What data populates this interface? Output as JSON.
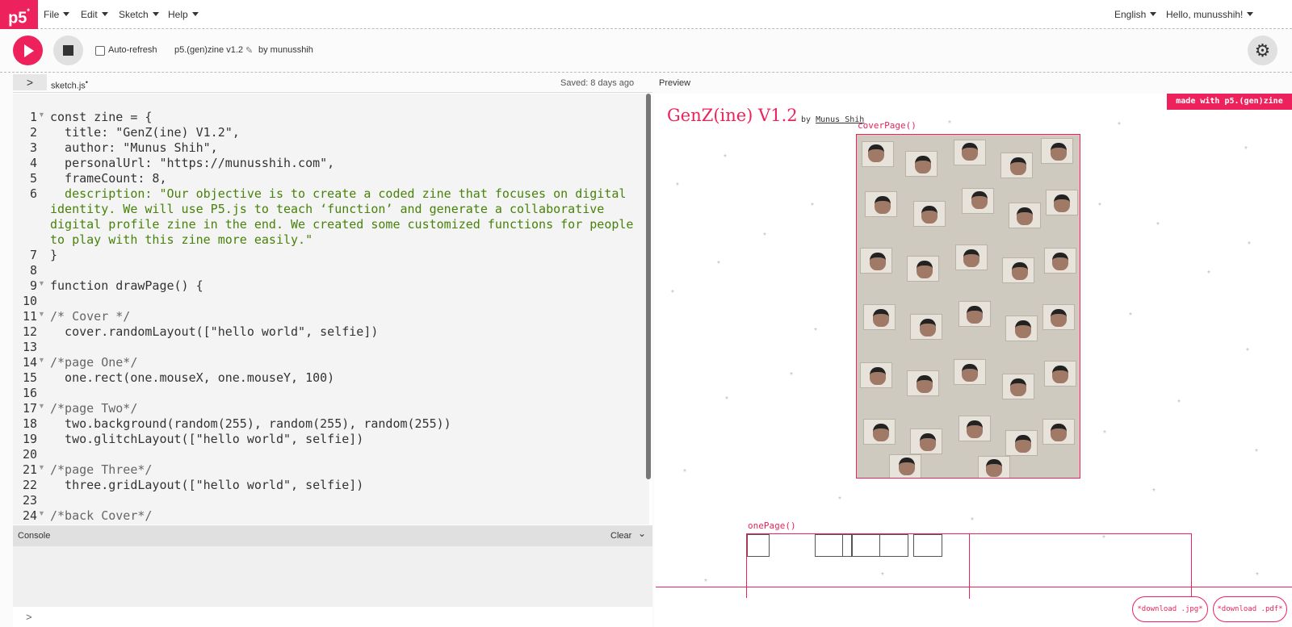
{
  "menubar": {
    "logo": "p5",
    "logo_sup": "*",
    "items": [
      "File",
      "Edit",
      "Sketch",
      "Help"
    ],
    "language": "English",
    "user": "Hello, munusshih!"
  },
  "toolbar": {
    "auto_refresh_label": "Auto-refresh",
    "sketch_name": "p5.(gen)zine v1.2",
    "by_user": "by munusshih"
  },
  "editor": {
    "toggle_glyph": ">",
    "filename": "sketch.js",
    "unsaved_marker": "•",
    "saved_status": "Saved: 8 days ago",
    "line_numbers": [
      "1",
      "2",
      "3",
      "4",
      "5",
      "6",
      "7",
      "8",
      "9",
      "10",
      "11",
      "12",
      "13",
      "14",
      "15",
      "16",
      "17",
      "18",
      "19",
      "20",
      "21",
      "22",
      "23",
      "24"
    ],
    "lines": [
      "const zine = {",
      "  title: \"GenZ(ine) V1.2\",",
      "  author: \"Munus Shih\",",
      "  personalUrl: \"https://munusshih.com\",",
      "  frameCount: 8,",
      "  description: \"Our objective is to create a coded zine that focuses on digital",
      "identity. We will use P5.js to teach ‘function’ and generate a collaborative",
      "digital profile zine in the end. We created some customized functions for people",
      "to play with this zine more easily.\"",
      "}",
      "",
      "function drawPage() {",
      "",
      "/* Cover */",
      "  cover.randomLayout([\"hello world\", selfie])",
      "",
      "/*page One*/",
      "  one.rect(one.mouseX, one.mouseY, 100)",
      "",
      "/*page Two*/",
      "  two.background(random(255), random(255), random(255))",
      "  two.glitchLayout([\"hello world\", selfie])",
      "",
      "/*page Three*/",
      "  three.gridLayout([\"hello world\", selfie])",
      "",
      "/*back Cover*/"
    ]
  },
  "console": {
    "label": "Console",
    "clear_label": "Clear",
    "prompt": ">"
  },
  "preview": {
    "label": "Preview",
    "made_with": "made with p5.(gen)zine",
    "zine_title": "GenZ(ine) V1.2",
    "by": "by",
    "author": "Munus Shih",
    "cover_label": "coverPage()",
    "one_label": "onePage()",
    "download_jpg": "*download .jpg*",
    "download_pdf": "*download .pdf*"
  },
  "colors": {
    "accent": "#ed225d",
    "keyword": "#0b7ca9",
    "string": "#47820a",
    "property": "#d52889"
  },
  "icons": {
    "play": "play-icon",
    "stop": "stop-icon",
    "gear": "gear-icon",
    "pencil": "pencil-icon"
  }
}
